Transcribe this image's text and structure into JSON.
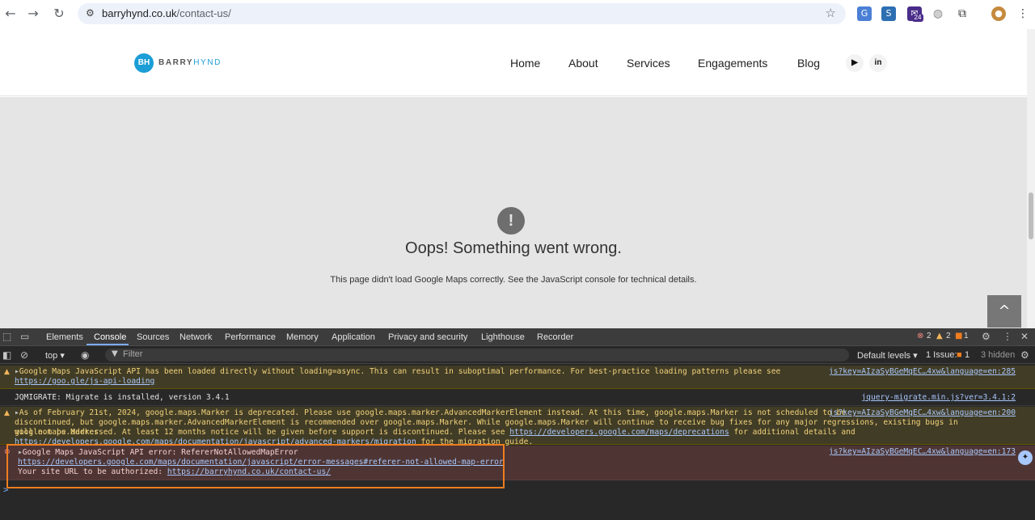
{
  "browser": {
    "url_host": "barryhynd.co.uk",
    "url_path": "/contact-us/",
    "extension_badge": "24"
  },
  "site": {
    "logo_mark": "BH",
    "logo_word_1": "BARRY",
    "logo_word_2": "HYND",
    "nav": [
      "Home",
      "About",
      "Services",
      "Engagements",
      "Blog"
    ],
    "social": [
      "youtube-icon",
      "linkedin-icon"
    ],
    "social_labels": {
      "youtube": "▶",
      "linkedin": "in"
    }
  },
  "map_error": {
    "icon": "!",
    "title": "Oops! Something went wrong.",
    "message": "This page didn't load Google Maps correctly. See the JavaScript console for technical details.",
    "scroll_top_glyph": "^"
  },
  "devtools": {
    "tabs": [
      "Elements",
      "Console",
      "Sources",
      "Network",
      "Performance",
      "Memory",
      "Application",
      "Privacy and security",
      "Lighthouse",
      "Recorder"
    ],
    "active_tab": "Console",
    "error_count": "2",
    "warning_count": "2",
    "issue_count": "1",
    "context": "top",
    "filter_placeholder": "Filter",
    "levels": "Default levels",
    "issues_label": "1 Issue:",
    "issues_count": "1",
    "hidden": "3 hidden",
    "messages": [
      {
        "level": "warn",
        "text": "Google Maps JavaScript API has been loaded directly without loading=async. This can result in suboptimal performance. For best-practice loading patterns please see",
        "link": "https://goo.gle/js-api-loading",
        "source": "js?key=AIzaSyBGeMqEC…4xw&language=en:285"
      },
      {
        "level": "log",
        "text": "JQMIGRATE: Migrate is installed, version 3.4.1",
        "source": "jquery-migrate.min.js?ver=3.4.1:2"
      },
      {
        "level": "warn",
        "text_1": "As of February 21st, 2024, google.maps.Marker is deprecated. Please use google.maps.marker.AdvancedMarkerElement instead. At this time, google.maps.Marker is not scheduled to be",
        "text_2": "discontinued, but google.maps.marker.AdvancedMarkerElement is recommended over google.maps.Marker. While google.maps.Marker will continue to receive bug fixes for any major regressions, existing bugs in google.maps.Marker",
        "text_3": "will not be addressed. At least 12 months notice will be given before support is discontinued. Please see",
        "link_1": "https://developers.google.com/maps/deprecations",
        "text_4": "for additional details and",
        "link_2": "https://developers.google.com/maps/documentation/javascript/advanced-markers/migration",
        "text_5": "for the migration guide.",
        "source": "js?key=AIzaSyBGeMqEC…4xw&language=en:200"
      },
      {
        "level": "error",
        "text": "Google Maps JavaScript API error: RefererNotAllowedMapError",
        "link": "https://developers.google.com/maps/documentation/javascript/error-messages#referer-not-allowed-map-error",
        "text_2": "Your site URL to be authorized:",
        "link_2": "https://barryhynd.co.uk/contact-us/",
        "source": "js?key=AIzaSyBGeMqEC…4xw&language=en:173"
      }
    ],
    "prompt": ">"
  },
  "colors": {
    "brand": "#1b9ed6",
    "highlight": "#f07d1e",
    "link": "#a8c7fa"
  }
}
